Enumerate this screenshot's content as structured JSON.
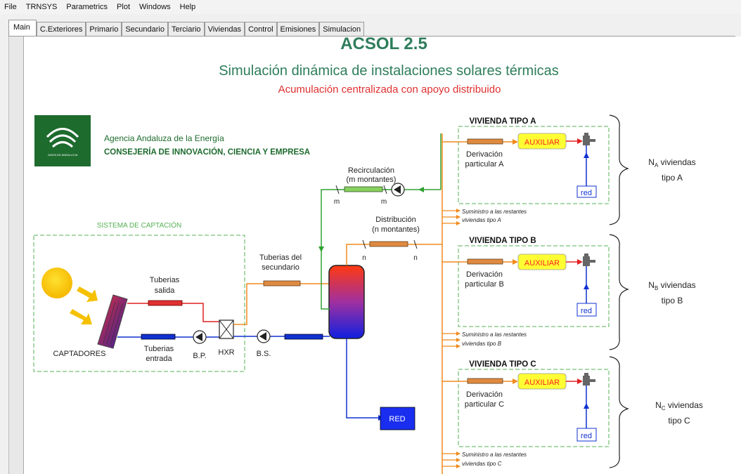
{
  "menu": [
    "File",
    "TRNSYS",
    "Parametrics",
    "Plot",
    "Windows",
    "Help"
  ],
  "tabs": [
    "Main",
    "C.Exteriores",
    "Primario",
    "Secundario",
    "Terciario",
    "Viviendas",
    "Control",
    "Emisiones",
    "Simulacion"
  ],
  "header": {
    "app_title": "ACSOL 2.5",
    "title": "Simulación dinámica de instalaciones solares térmicas",
    "subtitle": "Acumulación centralizada con apoyo distribuido"
  },
  "org": {
    "name": "Agencia Andaluza de la Energía",
    "ministry": "CONSEJERÍA DE INNOVACIÓN, CIENCIA Y EMPRESA",
    "logo_small_text": "JUNTA DE ANDALUCIA"
  },
  "captacion": {
    "title": "SISTEMA DE CAPTACIÓN",
    "tuberias_salida": [
      "Tuberias",
      "salida"
    ],
    "tuberias_entrada": [
      "Tuberias",
      "entrada"
    ],
    "captadores": "CAPTADORES",
    "bp": "B.P.",
    "hxr": "HXR"
  },
  "secundario": {
    "tuberias": [
      "Tuberias del",
      "secundario"
    ],
    "bs": "B.S.",
    "red": "RED"
  },
  "recirculacion": [
    "Recirculación",
    "(m montantes)"
  ],
  "distribucion": [
    "Distribución",
    "(n montantes)"
  ],
  "m": "m",
  "n": "n",
  "viviendas": [
    {
      "title": "VIVIENDA TIPO A",
      "derivacion": [
        "Derivación",
        "particular A"
      ],
      "auxiliar": "AUXILIAR",
      "red": "red",
      "suministro": [
        "Suministro a las restantes",
        "viviendas tipo A"
      ],
      "count_label_main": "N",
      "count_label_sub": "A",
      "count_label_rest": " viviendas",
      "count_label_line2": "tipo A"
    },
    {
      "title": "VIVIENDA TIPO B",
      "derivacion": [
        "Derivación",
        "particular B"
      ],
      "auxiliar": "AUXILIAR",
      "red": "red",
      "suministro": [
        "Suministro a las restantes",
        "viviendas tipo B"
      ],
      "count_label_main": "N",
      "count_label_sub": "B",
      "count_label_rest": " viviendas",
      "count_label_line2": "tipo B"
    },
    {
      "title": "VIVIENDA TIPO C",
      "derivacion": [
        "Derivación",
        "particular C"
      ],
      "auxiliar": "AUXILIAR",
      "red": "red",
      "suministro": [
        "Suministro a las restantes",
        "viviendas tipo C"
      ],
      "count_label_main": "N",
      "count_label_sub": "C",
      "count_label_rest": " viviendas",
      "count_label_line2": "tipo C"
    }
  ],
  "colors": {
    "title_green": "#2e7d5b",
    "subtitle_red": "#e03030",
    "org_green": "#1e6b2e",
    "hot_pipe": "#f08a1e",
    "red_pipe": "#e02020",
    "cold_pipe": "#1030d0",
    "dashed_green": "#55b055",
    "aux_fill": "#ffff33",
    "aux_text": "#ff2020"
  }
}
